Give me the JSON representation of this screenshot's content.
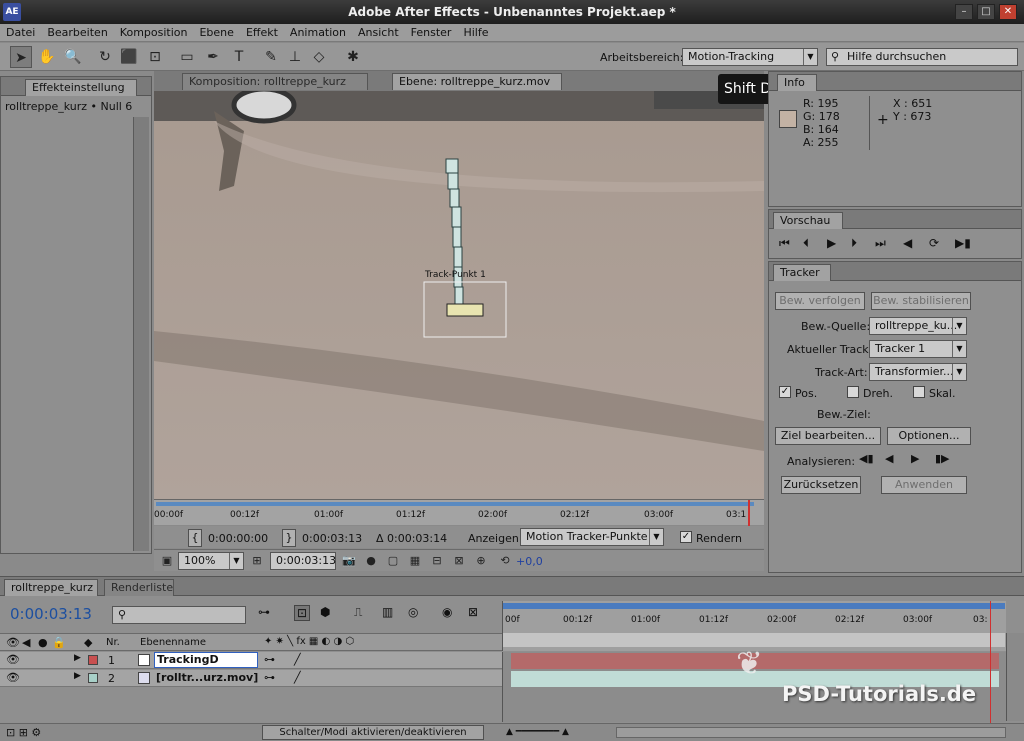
{
  "window": {
    "title": "Adobe After Effects - Unbenanntes Projekt.aep *",
    "icon": "AE",
    "controls": [
      "–",
      "□",
      "✕"
    ]
  },
  "menu": [
    "Datei",
    "Bearbeiten",
    "Komposition",
    "Ebene",
    "Effekt",
    "Animation",
    "Ansicht",
    "Fenster",
    "Hilfe"
  ],
  "toolbar": {
    "workspace_label": "Arbeitsbereich:",
    "workspace_value": "Motion-Tracking",
    "search_placeholder": "Hilfe durchsuchen"
  },
  "tooltip": "Shift D",
  "effects_panel": {
    "tab": "Effekteinstellung",
    "layer": "rolltreppe_kurz • Null 6"
  },
  "viewer": {
    "tab_comp": "Komposition: rolltreppe_kurz",
    "tab_layer": "Ebene: rolltreppe_kurz.mov",
    "track_label": "Track-Punkt 1",
    "ruler": [
      "00:00f",
      "00:12f",
      "01:00f",
      "01:12f",
      "02:00f",
      "02:12f",
      "03:00f",
      "03:1"
    ],
    "in_time": "0:00:00:00",
    "out_time": "0:00:03:13",
    "duration": "Δ 0:00:03:14",
    "show_label": "Anzeigen:",
    "show_value": "Motion Tracker-Punkte",
    "render_label": "Rendern",
    "zoom": "100%",
    "current_time": "0:00:03:13",
    "exposure": "+0,0"
  },
  "info": {
    "tab": "Info",
    "r": "R:  195",
    "g": "G:  178",
    "b": "B:  164",
    "a": "A:  255",
    "x": "X : 651",
    "y": "Y : 673",
    "swatch": "#c3b2a4"
  },
  "preview": {
    "tab": "Vorschau"
  },
  "tracker": {
    "tab": "Tracker",
    "btn_track": "Bew. verfolgen",
    "btn_stab": "Bew. stabilisieren",
    "source_label": "Bew.-Quelle:",
    "source_value": "rolltreppe_ku...",
    "current_label": "Aktueller Track:",
    "current_value": "Tracker 1",
    "type_label": "Track-Art:",
    "type_value": "Transformier...",
    "pos": "Pos.",
    "rot": "Dreh.",
    "scale": "Skal.",
    "target_label": "Bew.-Ziel:",
    "btn_edit": "Ziel bearbeiten...",
    "btn_options": "Optionen...",
    "analyze_label": "Analysieren:",
    "btn_reset": "Zurücksetzen",
    "btn_apply": "Anwenden"
  },
  "timeline": {
    "tab": "rolltreppe_kurz",
    "tab2": "Renderliste",
    "timecode": "0:00:03:13",
    "col_nr": "Nr.",
    "col_name": "Ebenenname",
    "ruler": [
      "00f",
      "00:12f",
      "01:00f",
      "01:12f",
      "02:00f",
      "02:12f",
      "03:00f",
      "03:"
    ],
    "layers": [
      {
        "nr": "1",
        "name": "TrackingD",
        "color": "#c85050"
      },
      {
        "nr": "2",
        "name": "[rolltr...urz.mov]",
        "color": "#a8d0c8"
      }
    ],
    "footer": "Schalter/Modi aktivieren/deaktivieren"
  },
  "watermark": "PSD-Tutorials.de"
}
